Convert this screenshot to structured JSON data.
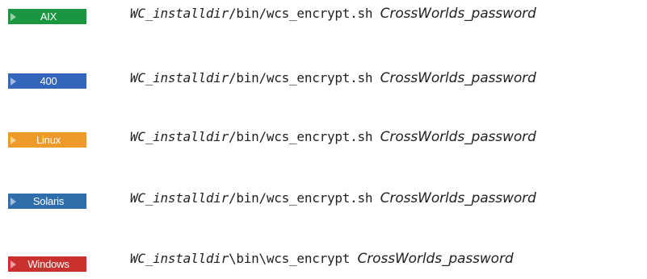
{
  "rows": [
    {
      "platform": "AIX",
      "color": "#1a9640",
      "command": {
        "var": "WC_installdir",
        "path": "/bin/wcs_encrypt.sh",
        "param": "CrossWorlds_password"
      }
    },
    {
      "platform": "400",
      "color": "#3366bb",
      "command": {
        "var": "WC_installdir",
        "path": "/bin/wcs_encrypt.sh",
        "param": "CrossWorlds_password"
      }
    },
    {
      "platform": "Linux",
      "color": "#ee9928",
      "command": {
        "var": "WC_installdir",
        "path": "/bin/wcs_encrypt.sh",
        "param": "CrossWorlds_password"
      }
    },
    {
      "platform": "Solaris",
      "color": "#2f6eaa",
      "command": {
        "var": "WC_installdir",
        "path": "/bin/wcs_encrypt.sh",
        "param": "CrossWorlds_password"
      }
    },
    {
      "platform": "Windows",
      "color": "#c8312e",
      "command": {
        "var": "WC_installdir",
        "path": "\\bin\\wcs_encrypt",
        "param": "CrossWorlds_password"
      }
    }
  ]
}
